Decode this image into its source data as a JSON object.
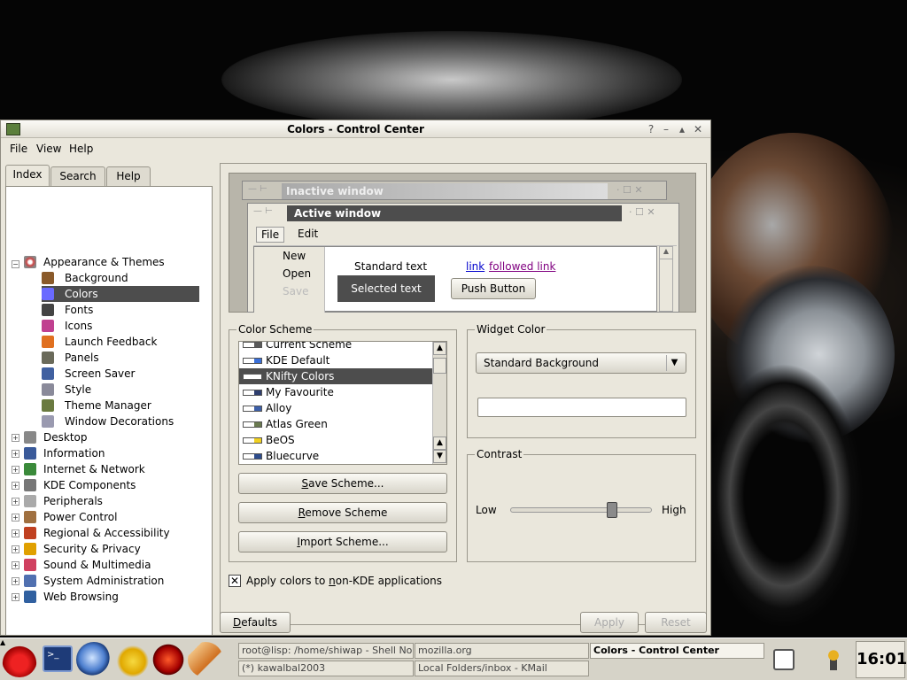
{
  "window": {
    "title": "Colors - Control Center"
  },
  "menubar": [
    "File",
    "View",
    "Help"
  ],
  "tabs": [
    "Index",
    "Search",
    "Help"
  ],
  "tree": {
    "root": "Appearance & Themes",
    "children": [
      "Background",
      "Colors",
      "Fonts",
      "Icons",
      "Launch Feedback",
      "Panels",
      "Screen Saver",
      "Style",
      "Theme Manager",
      "Window Decorations"
    ],
    "selected": "Colors",
    "others": [
      "Desktop",
      "Information",
      "Internet & Network",
      "KDE Components",
      "Peripherals",
      "Power Control",
      "Regional & Accessibility",
      "Security & Privacy",
      "Sound & Multimedia",
      "System Administration",
      "Web Browsing"
    ]
  },
  "preview": {
    "inactive_title": "Inactive window",
    "active_title": "Active window",
    "menu": [
      "File",
      "Edit"
    ],
    "file_menu_items": [
      "New",
      "Open",
      "Save"
    ],
    "standard_text": "Standard text",
    "selected_text": "Selected text",
    "link": "link",
    "followed_link": "followed link",
    "push_button": "Push Button"
  },
  "color_scheme": {
    "title": "Color Scheme",
    "items": [
      {
        "name": "Current Scheme",
        "color": "#5a5a5a"
      },
      {
        "name": "KDE Default",
        "color": "#3a6fd8"
      },
      {
        "name": "KNifty Colors",
        "color": "#ffffff"
      },
      {
        "name": "My Favourite",
        "color": "#2e3e6e"
      },
      {
        "name": "Alloy",
        "color": "#3d5fa8"
      },
      {
        "name": "Atlas Green",
        "color": "#6a7a50"
      },
      {
        "name": "BeOS",
        "color": "#f0d020"
      },
      {
        "name": "Bluecurve",
        "color": "#2d4c8c"
      }
    ],
    "selected": "KNifty Colors",
    "save_button": "Save Scheme...",
    "remove_button": "Remove Scheme",
    "import_button": "Import Scheme..."
  },
  "widget_color": {
    "title": "Widget Color",
    "selected": "Standard Background"
  },
  "contrast": {
    "title": "Contrast",
    "low_label": "Low",
    "high_label": "High",
    "value": 0.72
  },
  "apply_checkbox": {
    "label": "Apply colors to non-KDE applications",
    "checked": true
  },
  "buttons": {
    "defaults": "Defaults",
    "apply": "Apply",
    "reset": "Reset"
  },
  "taskbar": {
    "tasks": [
      "root@lisp: /home/shiwap - Shell No.",
      "mozilla.org",
      "Colors - Control Center",
      "(*) kawalbal2003",
      "Local Folders/inbox - KMail"
    ],
    "clock": "16:01"
  }
}
